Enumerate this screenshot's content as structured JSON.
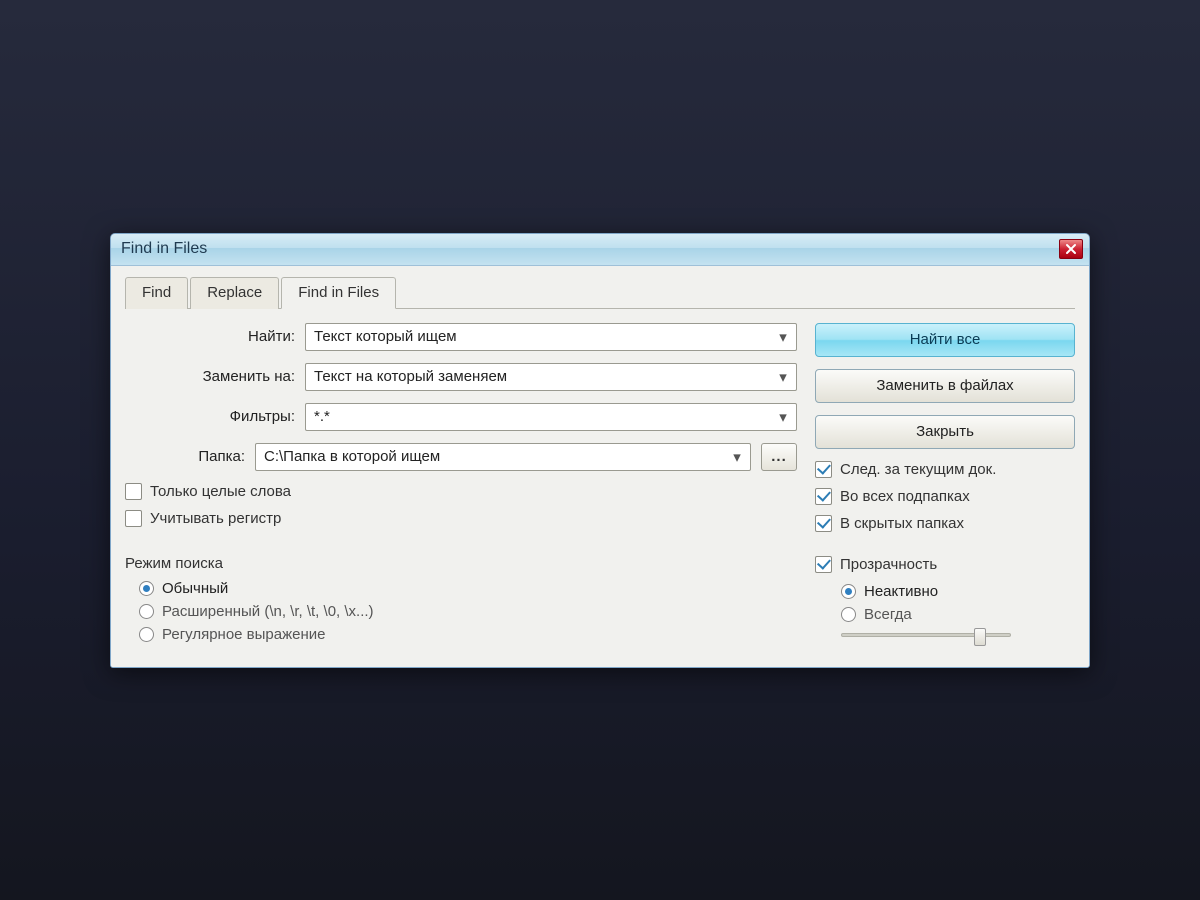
{
  "window": {
    "title": "Find in Files"
  },
  "tabs": {
    "find": "Find",
    "replace": "Replace",
    "find_in_files": "Find in Files"
  },
  "labels": {
    "find": "Найти:",
    "replace_with": "Заменить на:",
    "filters": "Фильтры:",
    "folder": "Папка:"
  },
  "fields": {
    "find": "Текст который ищем",
    "replace_with": "Текст на который заменяем",
    "filters": "*.*",
    "folder": "C:\\Папка в которой ищем"
  },
  "browse": "...",
  "buttons": {
    "find_all": "Найти все",
    "replace_in_files": "Заменить в файлах",
    "close": "Закрыть"
  },
  "opts_left": {
    "whole_words": "Только целые слова",
    "match_case": "Учитывать регистр"
  },
  "opts_right": {
    "follow_doc": "След. за текущим док.",
    "subfolders": "Во всех подпапках",
    "hidden": "В скрытых папках"
  },
  "search_mode": {
    "legend": "Режим поиска",
    "normal": "Обычный",
    "extended": "Расширенный (\\n, \\r, \\t, \\0, \\x...)",
    "regex": "Регулярное выражение"
  },
  "transparency": {
    "legend": "Прозрачность",
    "inactive": "Неактивно",
    "always": "Всегда"
  }
}
